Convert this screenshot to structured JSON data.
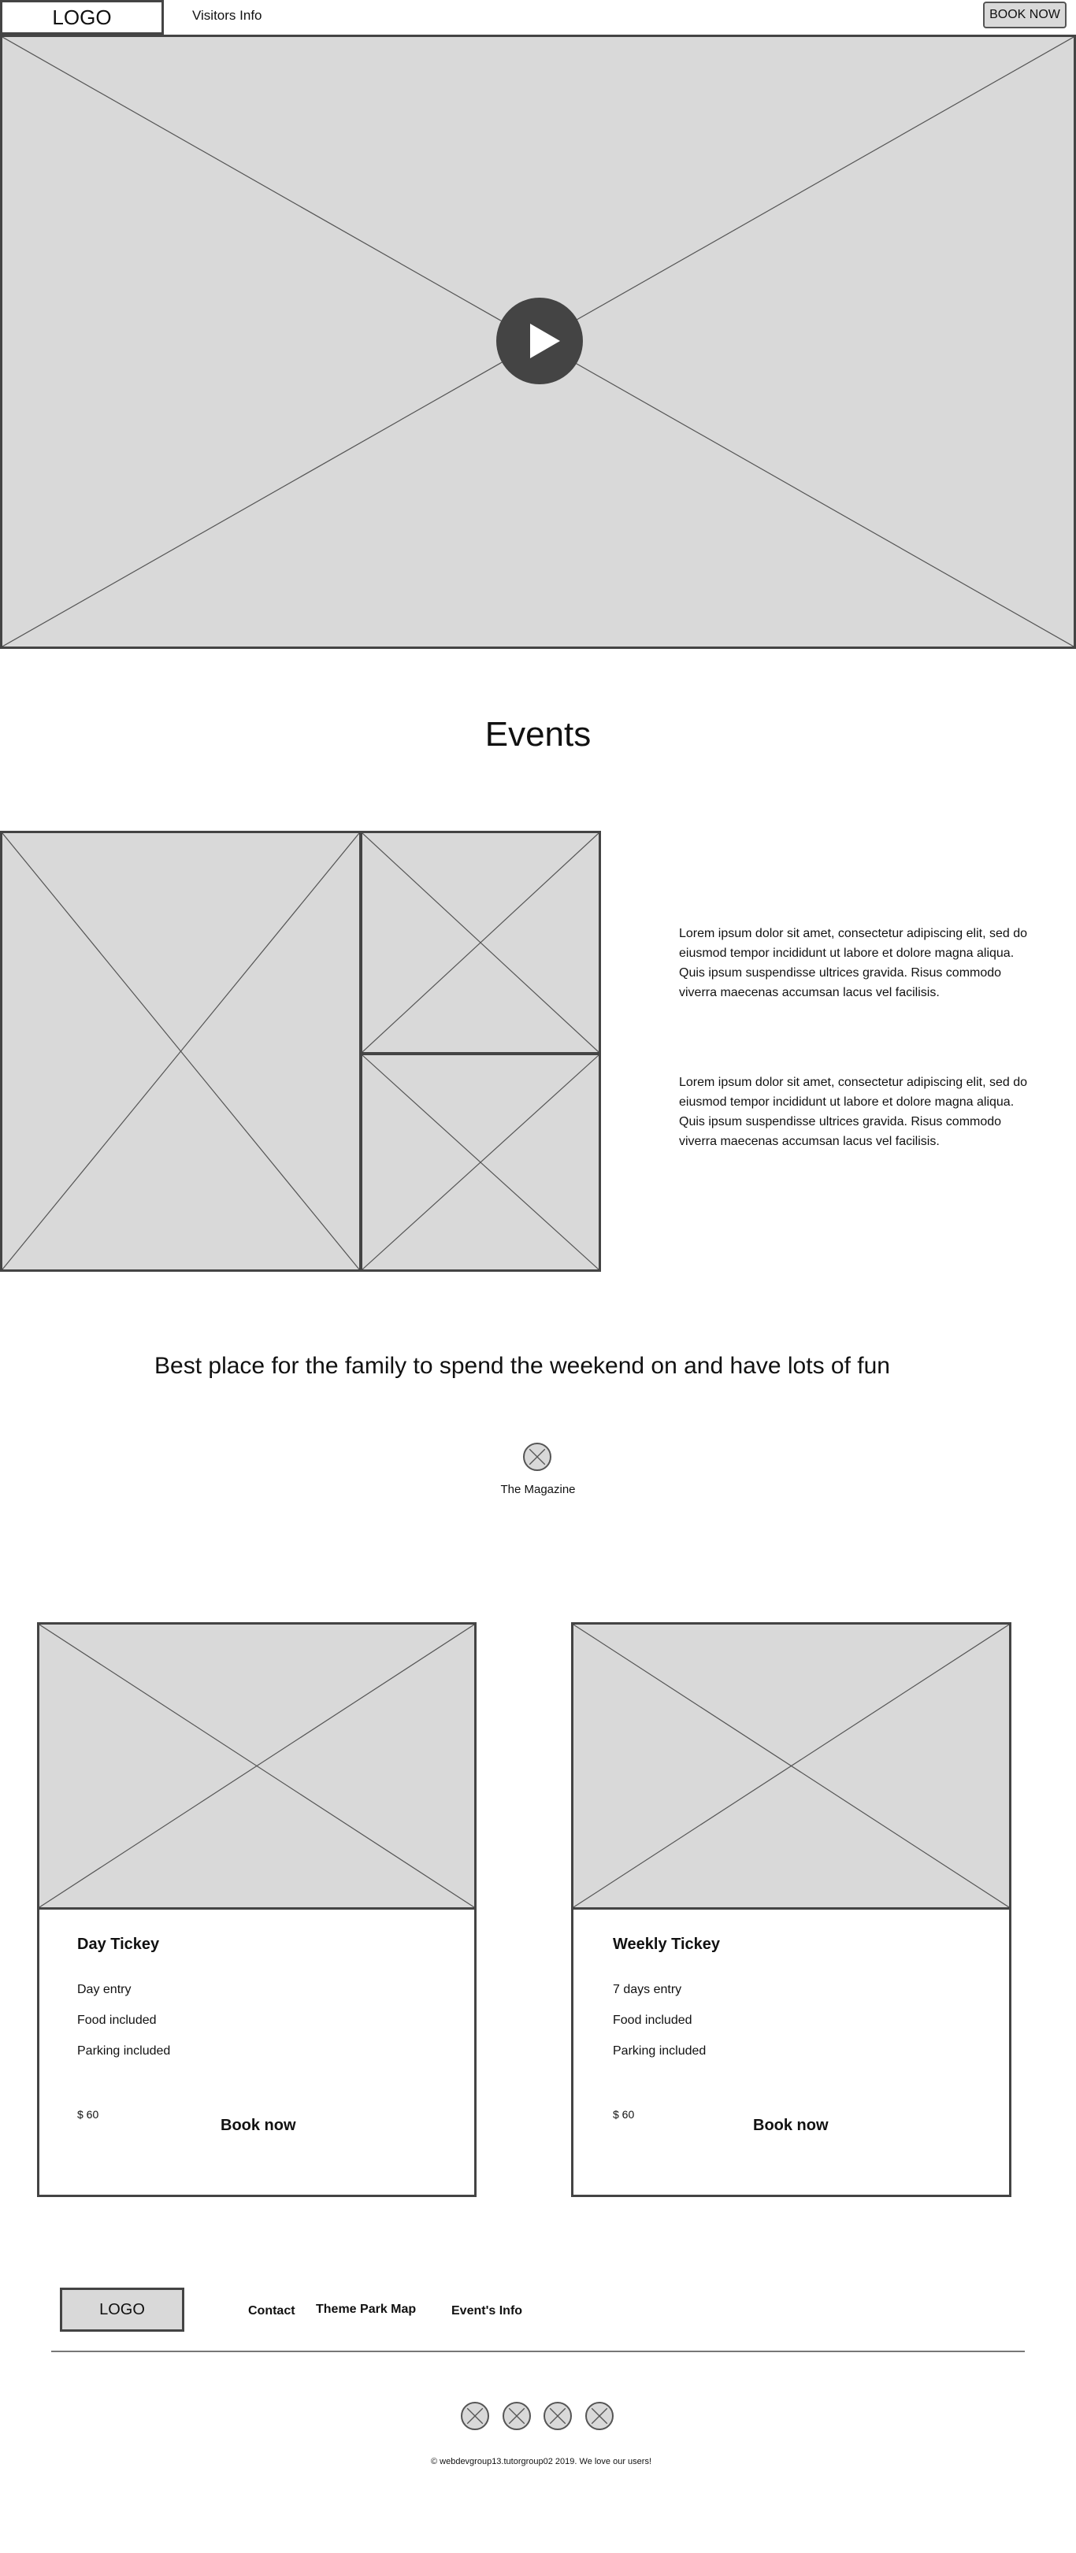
{
  "header": {
    "logo": "LOGO",
    "nav_visitors": "Visitors Info",
    "book_now": "BOOK NOW"
  },
  "hero": {
    "play_icon": "play-icon"
  },
  "events": {
    "title": "Events",
    "paragraphs": [
      "Lorem ipsum dolor sit amet, consectetur adipiscing elit, sed do eiusmod tempor incididunt ut labore et dolore magna aliqua. Quis ipsum suspendisse ultrices gravida. Risus commodo viverra maecenas accumsan lacus vel facilisis.",
      "Lorem ipsum dolor sit amet, consectetur adipiscing elit, sed do eiusmod tempor incididunt ut labore et dolore magna aliqua. Quis ipsum suspendisse ultrices gravida. Risus commodo viverra maecenas accumsan lacus vel facilisis."
    ]
  },
  "tagline": "Best place for the family to spend the weekend on and  have lots of fun",
  "magazine": {
    "label": "The Magazine",
    "icon": "magazine-icon"
  },
  "tickets": [
    {
      "title": "Day Tickey",
      "items": [
        "Day entry",
        "Food included",
        "Parking included"
      ],
      "price": "$ 60",
      "book": "Book now"
    },
    {
      "title": "Weekly Tickey",
      "items": [
        "7 days entry",
        "Food included",
        "Parking included"
      ],
      "price": "$ 60",
      "book": "Book now"
    }
  ],
  "footer": {
    "logo": "LOGO",
    "links": [
      "Contact",
      "Theme Park Map",
      "Event's Info"
    ],
    "social_icons": [
      "social-icon-1",
      "social-icon-2",
      "social-icon-3",
      "social-icon-4"
    ],
    "copyright": "© webdevgroup13.tutorgroup02 2019. We love our users!"
  },
  "colors": {
    "placeholder": "#d9d9d9",
    "border": "#444444",
    "play": "#444444"
  }
}
